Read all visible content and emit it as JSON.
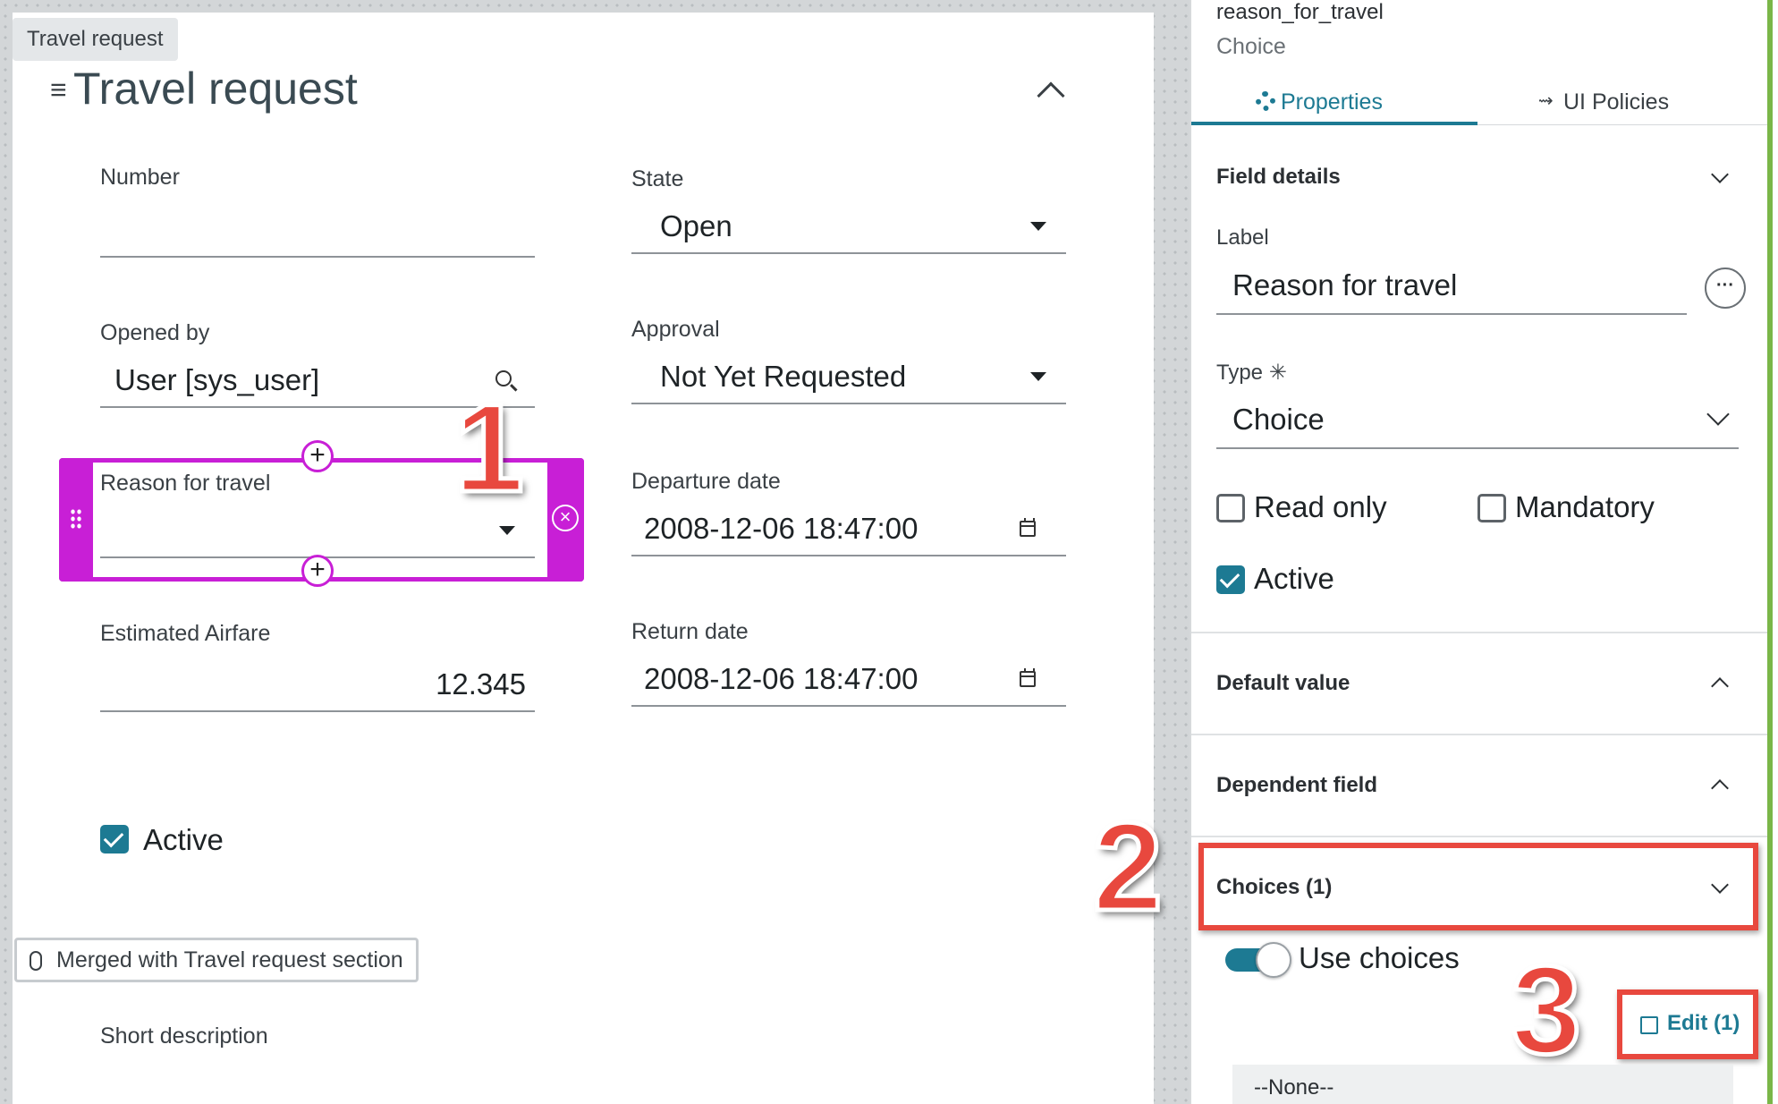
{
  "form": {
    "section_tag": "Travel request",
    "title": "Travel request",
    "fields": {
      "number": {
        "label": "Number",
        "value": ""
      },
      "state": {
        "label": "State",
        "value": "Open"
      },
      "opened_by": {
        "label": "Opened by",
        "value": "User [sys_user]"
      },
      "approval": {
        "label": "Approval",
        "value": "Not Yet Requested"
      },
      "reason_for_travel": {
        "label": "Reason for travel",
        "value": ""
      },
      "departure_date": {
        "label": "Departure date",
        "value": "2008-12-06 18:47:00"
      },
      "estimated_airfare": {
        "label": "Estimated Airfare",
        "value": "12.345"
      },
      "return_date": {
        "label": "Return date",
        "value": "2008-12-06 18:47:00"
      },
      "active": {
        "label": "Active",
        "checked": true
      }
    },
    "merged_tag": "Merged with Travel request section",
    "short_description_label": "Short description"
  },
  "annotations": {
    "step1": "1",
    "step2": "2",
    "step3": "3",
    "color": "#e8483e"
  },
  "panel": {
    "field_name": "reason_for_travel",
    "field_type": "Choice",
    "tabs": [
      {
        "label": "Properties",
        "icon": "gear-icon",
        "active": true
      },
      {
        "label": "UI Policies",
        "icon": "policy-icon",
        "active": false
      }
    ],
    "field_details": {
      "title": "Field details",
      "label_caption": "Label",
      "label_value": "Reason for travel",
      "type_caption": "Type",
      "type_required_mark": "✳",
      "type_value": "Choice",
      "read_only": {
        "label": "Read only",
        "checked": false
      },
      "mandatory": {
        "label": "Mandatory",
        "checked": false
      },
      "active": {
        "label": "Active",
        "checked": true
      }
    },
    "default_value_title": "Default value",
    "dependent_field_title": "Dependent field",
    "choices_title": "Choices (1)",
    "use_choices": {
      "label": "Use choices",
      "on": true
    },
    "edit_link": "Edit (1)",
    "choice_items": [
      "--None--"
    ]
  },
  "colors": {
    "accent": "#1d7a93",
    "selection": "#c81fd6",
    "annotation": "#e8483e"
  }
}
